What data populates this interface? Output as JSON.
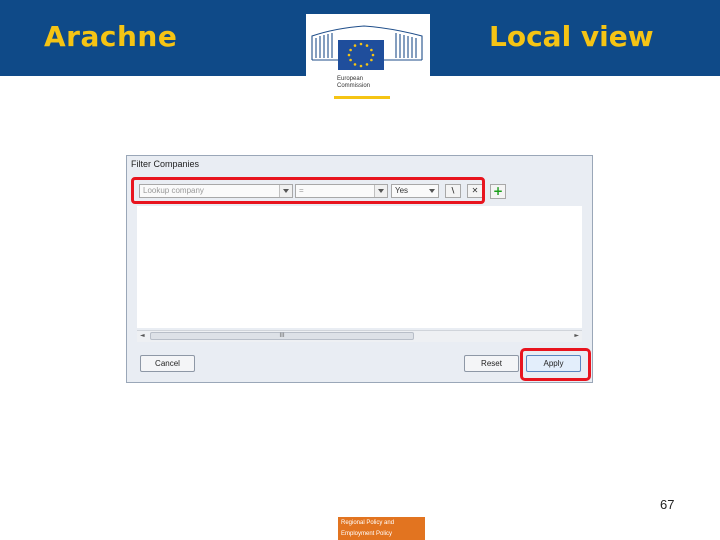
{
  "slide": {
    "title_left": "Arachne",
    "title_right": "Local view",
    "page_number": "67",
    "footer": {
      "line1": "Regional Policy and",
      "line2": "Employment Policy"
    }
  },
  "logo": {
    "line1": "European",
    "line2": "Commission"
  },
  "dialog": {
    "title": "Filter Companies",
    "filter": {
      "field": "Lookup company",
      "operator": "=",
      "value": "Yes",
      "value_select_icon": "lookup-icon",
      "clear_icon": "clear-icon",
      "add_icon": "add-icon"
    },
    "scrollbar_grip": "III",
    "buttons": {
      "cancel": "Cancel",
      "reset": "Reset",
      "apply": "Apply"
    }
  },
  "colors": {
    "header_bg": "#0f4a88",
    "header_text": "#f5c414",
    "highlight": "#e8141e",
    "footer_badge": "#e27420",
    "add_green": "#1a9e1a"
  }
}
